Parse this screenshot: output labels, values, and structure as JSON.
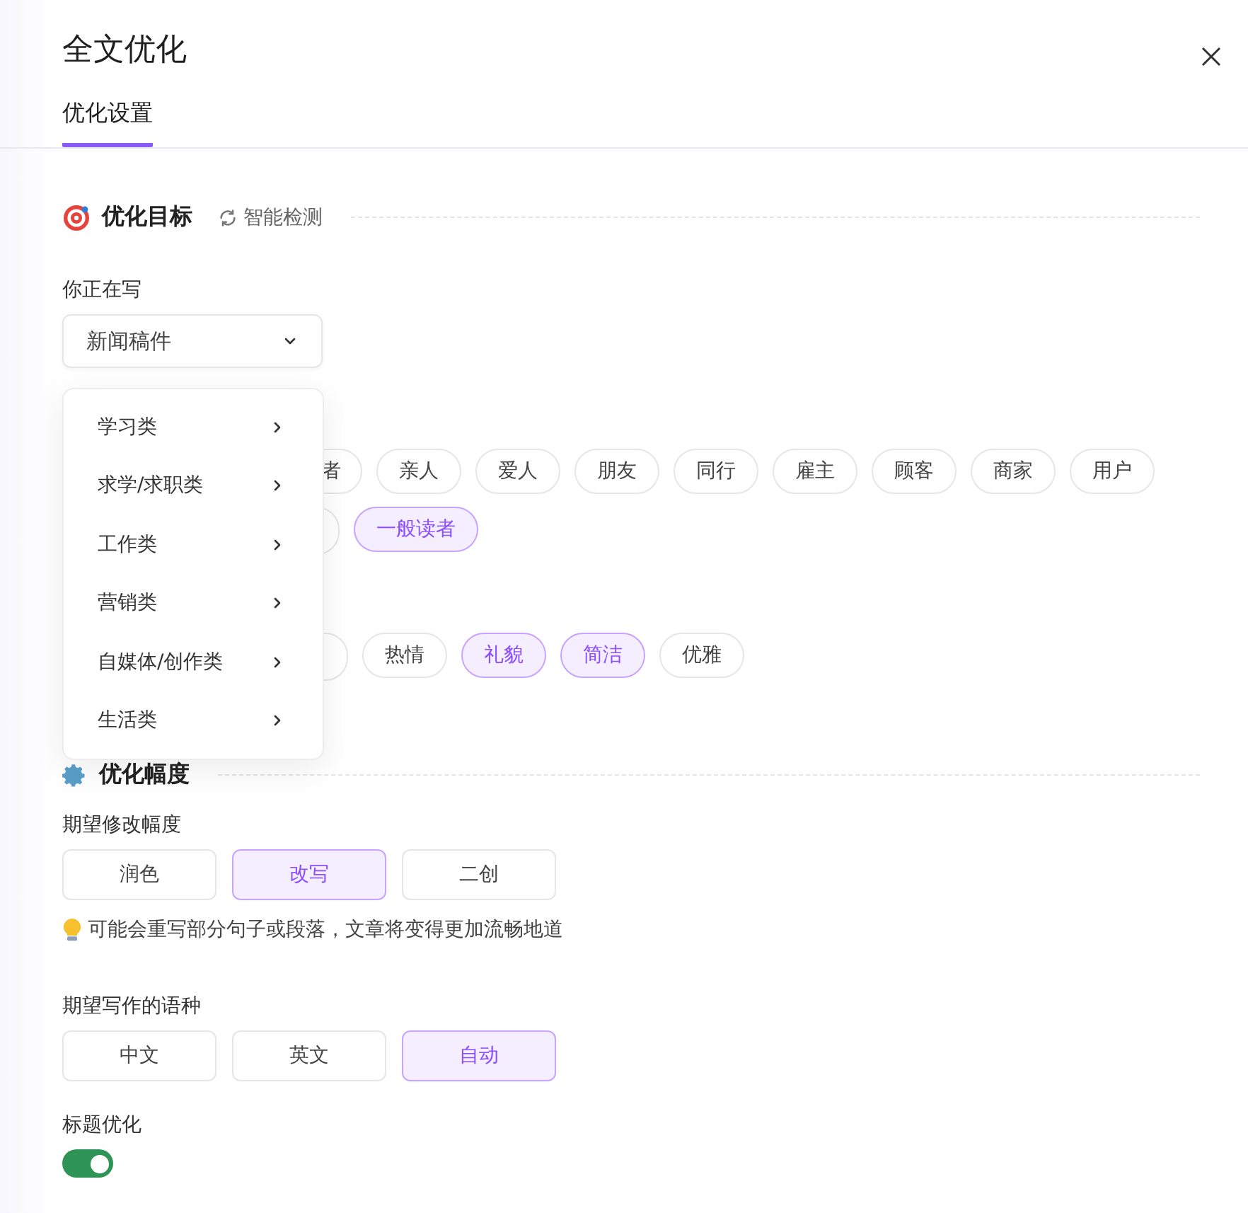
{
  "title": "全文优化",
  "tabs": [
    {
      "label": "优化设置",
      "selected": true
    }
  ],
  "goal_section": {
    "title": "优化目标",
    "action": "智能检测"
  },
  "writing_type": {
    "label": "你正在写",
    "value": "新闻稿件"
  },
  "dropdown_menu": [
    {
      "label": "学习类"
    },
    {
      "label": "求学/求职类"
    },
    {
      "label": "工作类"
    },
    {
      "label": "营销类"
    },
    {
      "label": "自媒体/创作类"
    },
    {
      "label": "生活类"
    }
  ],
  "audience_rows": [
    [
      {
        "kind": "cut",
        "label": "者",
        "selected": false
      },
      {
        "kind": "chip",
        "label": "亲人",
        "selected": false
      },
      {
        "kind": "chip",
        "label": "爱人",
        "selected": false
      },
      {
        "kind": "chip",
        "label": "朋友",
        "selected": false
      },
      {
        "kind": "chip",
        "label": "同行",
        "selected": false
      },
      {
        "kind": "chip",
        "label": "雇主",
        "selected": false
      },
      {
        "kind": "chip",
        "label": "顾客",
        "selected": false
      },
      {
        "kind": "chip",
        "label": "商家",
        "selected": false
      },
      {
        "kind": "chip",
        "label": "用户",
        "selected": false
      }
    ],
    [
      {
        "kind": "stub"
      },
      {
        "kind": "chip",
        "label": "一般读者",
        "selected": true
      }
    ]
  ],
  "tone_chips": [
    {
      "kind": "stub"
    },
    {
      "kind": "chip",
      "label": "热情",
      "selected": false
    },
    {
      "kind": "chip",
      "label": "礼貌",
      "selected": true
    },
    {
      "kind": "chip",
      "label": "简洁",
      "selected": true
    },
    {
      "kind": "chip",
      "label": "优雅",
      "selected": false
    }
  ],
  "strength_section": {
    "title": "优化幅度"
  },
  "rewrite_level": {
    "label": "期望修改幅度",
    "options": [
      {
        "label": "润色",
        "selected": false
      },
      {
        "label": "改写",
        "selected": true
      },
      {
        "label": "二创",
        "selected": false
      }
    ],
    "hint": "可能会重写部分句子或段落，文章将变得更加流畅地道"
  },
  "language": {
    "label": "期望写作的语种",
    "options": [
      {
        "label": "中文",
        "selected": false
      },
      {
        "label": "英文",
        "selected": false
      },
      {
        "label": "自动",
        "selected": true
      }
    ]
  },
  "title_optimization": {
    "label": "标题优化",
    "on": true
  }
}
